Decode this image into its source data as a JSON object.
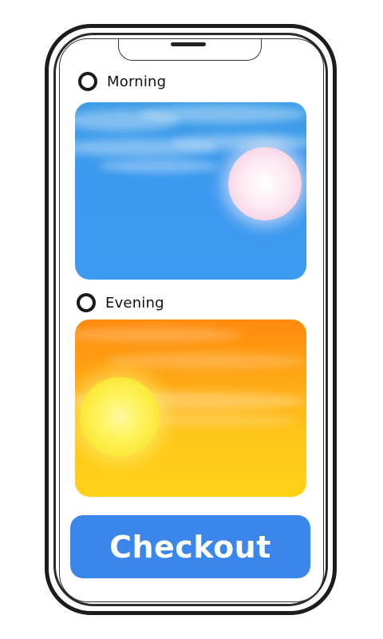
{
  "options": [
    {
      "label": "Morning",
      "selected": false,
      "image_icon": "morning-sky-sun-image"
    },
    {
      "label": "Evening",
      "selected": false,
      "image_icon": "evening-sky-sunset-image"
    }
  ],
  "checkout": {
    "label": "Checkout"
  },
  "colors": {
    "accent": "#3a86ea",
    "morning_sky": "#3c9af2",
    "evening_sky_top": "#ff8a0d",
    "evening_sky_bottom": "#ffd216"
  }
}
